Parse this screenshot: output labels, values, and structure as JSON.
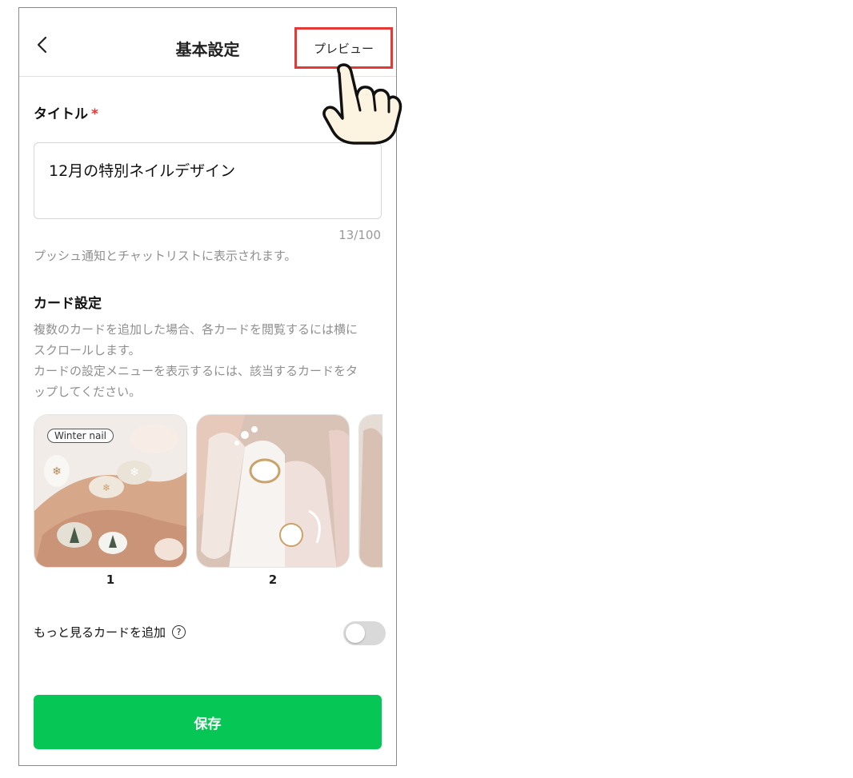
{
  "header": {
    "title": "基本設定",
    "preview_label": "プレビュー"
  },
  "title_field": {
    "label": "タイトル",
    "required_mark": "*",
    "value": "12月の特別ネイルデザイン",
    "counter": "13/100",
    "helper": "プッシュ通知とチャットリストに表示されます。"
  },
  "card_settings": {
    "label": "カード設定",
    "desc_line1": "複数のカードを追加した場合、各カードを閲覧するには横に",
    "desc_line2": "スクロールします。",
    "desc_line3": "カードの設定メニューを表示するには、該当するカードをタ",
    "desc_line4": "ップしてください。",
    "cards": [
      {
        "number": "1",
        "tag": "Winter nail"
      },
      {
        "number": "2"
      }
    ]
  },
  "more_cards": {
    "label": "もっと見るカードを追加",
    "help_icon": "question-circle-icon",
    "enabled": false
  },
  "save_label": "保存",
  "colors": {
    "accent_green": "#06c755",
    "highlight_red": "#e53935"
  }
}
